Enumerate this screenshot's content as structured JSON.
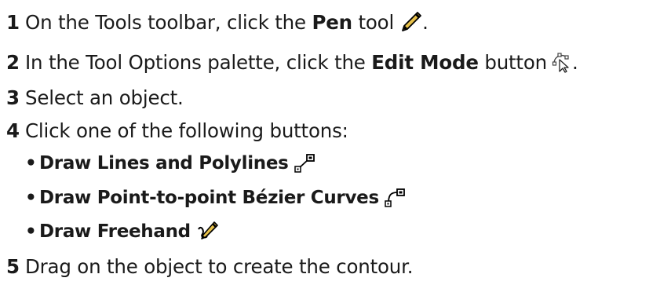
{
  "steps": [
    {
      "num": "1",
      "pre": "On the Tools toolbar, click the ",
      "bold": "Pen",
      "post": " tool",
      "icon": "pen-tool-icon",
      "tail": "."
    },
    {
      "num": "2",
      "pre": "In the Tool Options palette, click the ",
      "bold": "Edit Mode",
      "post": " button",
      "icon": "edit-mode-icon",
      "tail": "."
    },
    {
      "num": "3",
      "text": "Select an object."
    },
    {
      "num": "4",
      "text": "Click one of the following buttons:"
    },
    {
      "num": "5",
      "text": "Drag on the object to create the contour."
    }
  ],
  "bullet": "•",
  "sub_items": [
    {
      "label": "Draw Lines and Polylines",
      "icon": "draw-lines-icon"
    },
    {
      "label": "Draw Point-to-point Bézier Curves",
      "icon": "bezier-curves-icon"
    },
    {
      "label": "Draw Freehand",
      "icon": "freehand-icon"
    }
  ],
  "colors": {
    "text": "#1a1a1a",
    "icon_fill": "#e8c24a",
    "icon_outline": "#000000"
  }
}
